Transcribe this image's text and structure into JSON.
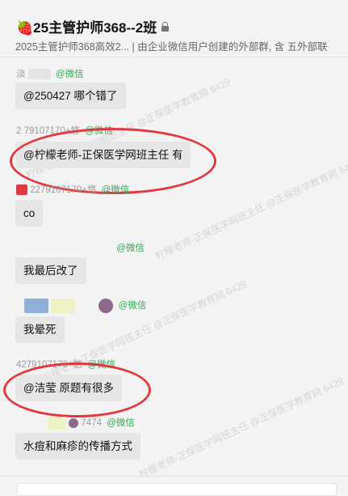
{
  "header": {
    "title": "🍓25主管护师368--2班",
    "subtitle": "2025主管护师368高效2...  | 由企业微信用户创建的外部群, 含     五外部联"
  },
  "wechat_label": "@微信",
  "messages": [
    {
      "sender": "淡",
      "bubble": "@250427           哪个错了"
    },
    {
      "sender": "2    79107170+悠",
      "bubble": "@柠檬老师-正保医学网班主任 有"
    },
    {
      "sender": "2279107170+悠",
      "bubble": "co"
    },
    {
      "sender": "",
      "bubble": "我最后改了"
    },
    {
      "sender": "",
      "bubble": "我晕死"
    },
    {
      "sender": "4279107170+悠",
      "bubble": "@洁莹 原题有很多"
    },
    {
      "sender": "7474",
      "bubble": "水痘和麻疹的传播方式"
    }
  ],
  "watermark": "柠檬老师-正保医学网班主任 @正保医学教育网 6429",
  "colors": {
    "highlight": "#e0393e",
    "wechat": "#3aa65a",
    "bubble": "#e6e6e6"
  }
}
